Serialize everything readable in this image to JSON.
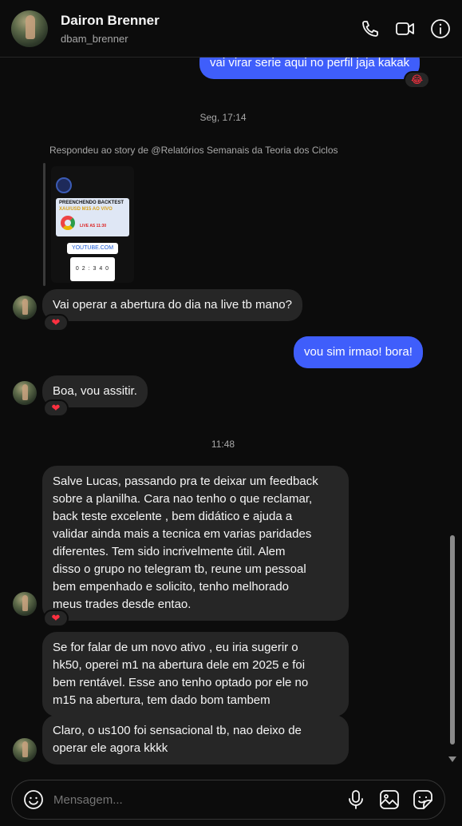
{
  "header": {
    "name": "Dairon Brenner",
    "username": "dbam_brenner",
    "call_icon": "phone-icon",
    "video_icon": "video-icon",
    "info_icon": "info-icon"
  },
  "messages": {
    "m0": {
      "text": "vai virar serie aqui no perfil jaja kakak",
      "reaction": "😂"
    },
    "ts1": "Seg, 17:14",
    "story_reply": "Respondeu ao story de @Relatórios Semanais da Teoria dos Ciclos",
    "story": {
      "title": "PREENCHENDO BACKTEST",
      "subtitle": "XAU/USD M15 AO VIVO",
      "live": "LIVE AS 11:30",
      "link": "YOUTUBE.COM",
      "countdown": "0 2 : 3 4 0"
    },
    "m1": {
      "text": "Vai operar a abertura do dia na live tb mano?",
      "reaction": "❤"
    },
    "m2": {
      "text": "vou sim irmao! bora!"
    },
    "m3": {
      "text": "Boa, vou assitir.",
      "reaction": "❤"
    },
    "ts2": "11:48",
    "m4": {
      "lines": [
        "Salve Lucas, passando pra te deixar um feedback",
        "sobre a planilha. Cara nao tenho o que reclamar,",
        "back teste excelente  , bem didático  e ajuda a",
        "validar ainda mais a tecnica em varias paridades",
        "diferentes.  Tem sido incrivelmente  útil.  Alem",
        "disso o grupo no telegram tb, reune um pessoal",
        "bem empenhado e solicito, tenho melhorado",
        "meus trades desde entao."
      ],
      "reaction": "❤"
    },
    "m5": {
      "lines": [
        "Se for falar de um novo ativo , eu iria sugerir o",
        "hk50, operei m1 na abertura dele em 2025 e foi",
        "bem rentável.  Esse ano tenho optado por ele no",
        "m15 na abertura, tem dado bom tambem"
      ]
    },
    "m6": {
      "lines": [
        "Claro, o us100 foi sensacional tb, nao deixo de",
        "operar ele agora kkkk"
      ]
    }
  },
  "composer": {
    "placeholder": "Mensagem...",
    "emoji_icon": "emoji-icon",
    "mic_icon": "microphone-icon",
    "image_icon": "image-icon",
    "sticker_icon": "sticker-icon"
  },
  "colors": {
    "outgoing": "#3f5efb",
    "incoming": "#262626",
    "background": "#0c0c0c"
  }
}
